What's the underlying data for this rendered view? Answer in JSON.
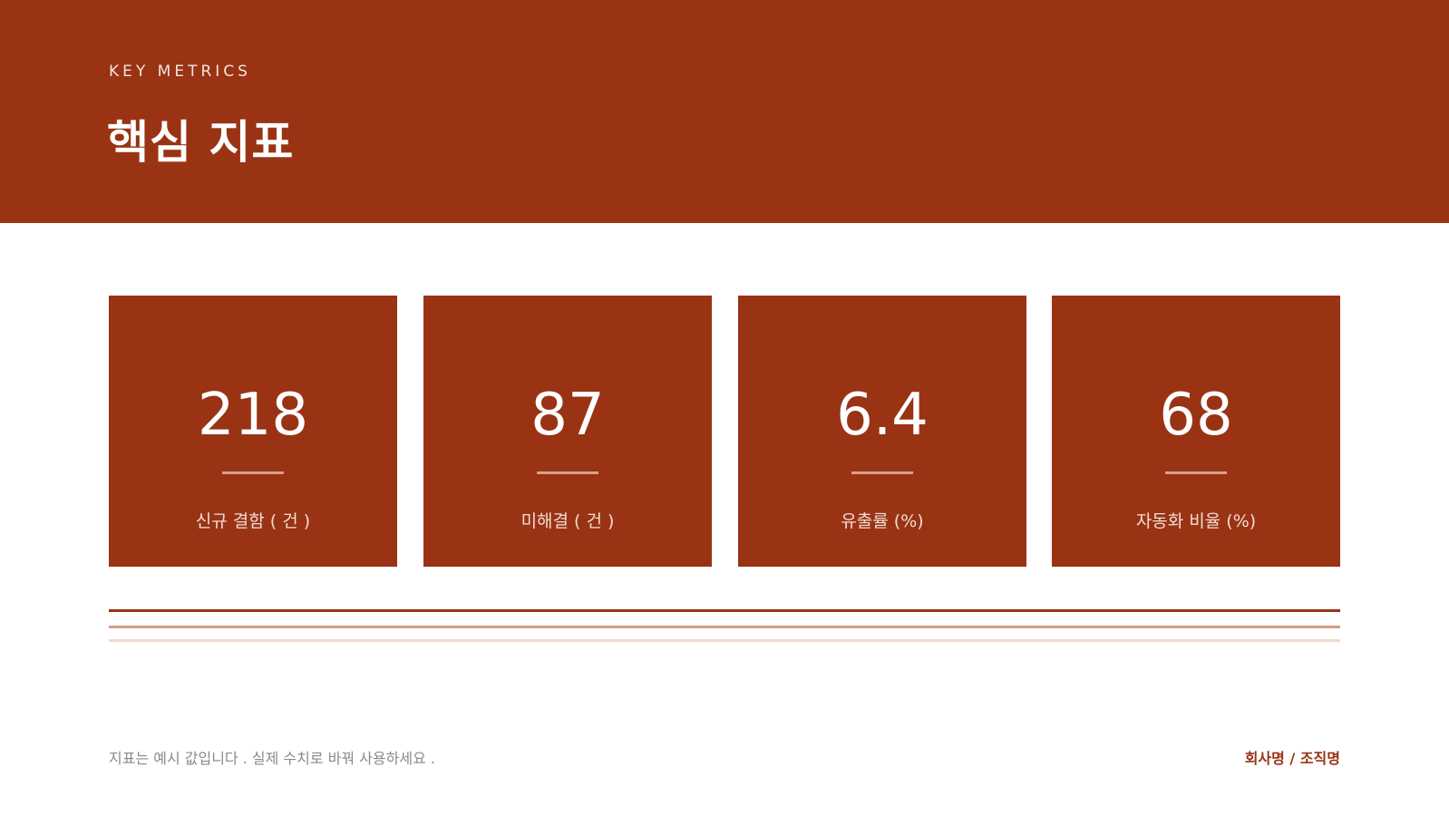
{
  "header": {
    "eyebrow": "KEY METRICS",
    "title": "핵심 지표"
  },
  "metrics": [
    {
      "value": "218",
      "label": "신규 결함 ( 건 )"
    },
    {
      "value": "87",
      "label": "미해결 ( 건 )"
    },
    {
      "value": "6.4",
      "label": "유출률 (%)"
    },
    {
      "value": "68",
      "label": "자동화 비율 (%)"
    }
  ],
  "footer": {
    "note": "지표는 예시 값입니다 .  실제 수치로 바꿔 사용하세요 .",
    "organization": "회사명  /  조직명"
  },
  "colors": {
    "accent": "#993314",
    "accent_light": "#d89c85",
    "accent_pale": "#f0d9cf"
  }
}
